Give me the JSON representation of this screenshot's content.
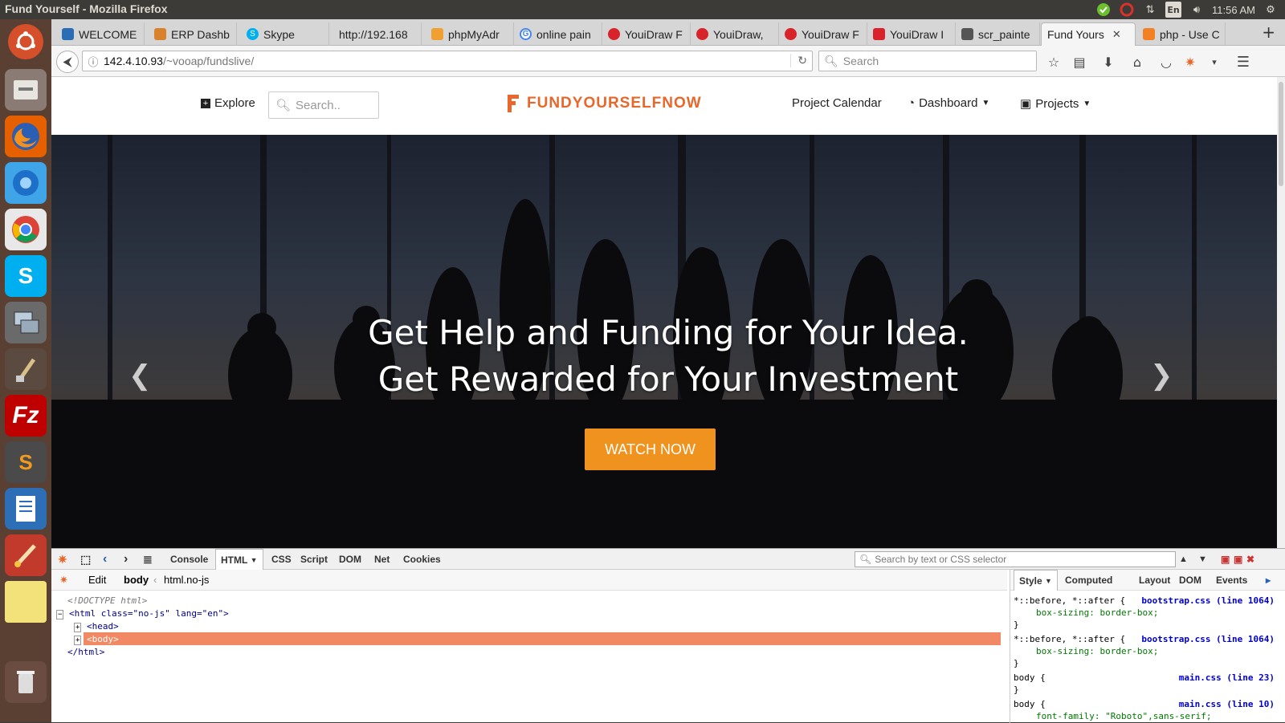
{
  "system": {
    "window_title": "Fund Yourself - Mozilla Firefox",
    "clock": "11:56 AM",
    "lang": "En"
  },
  "tabs": [
    {
      "label": "WELCOME TO",
      "fav": "#2a6db5"
    },
    {
      "label": "ERP Dashb",
      "fav": "#d9822b"
    },
    {
      "label": "Skype",
      "fav": "#00aff0"
    },
    {
      "label": "http://192.168",
      "fav": ""
    },
    {
      "label": "phpMyAdr",
      "fav": "#f0a030"
    },
    {
      "label": "online pain",
      "fav": "#4285f4"
    },
    {
      "label": "YouiDraw F",
      "fav": "#d8232a"
    },
    {
      "label": "YouiDraw,",
      "fav": "#d8232a"
    },
    {
      "label": "YouiDraw F",
      "fav": "#d8232a"
    },
    {
      "label": "YouiDraw I",
      "fav": "#d8232a"
    },
    {
      "label": "scr_painte",
      "fav": "#555"
    },
    {
      "label": "Fund Yours",
      "fav": "",
      "active": true
    },
    {
      "label": "php - Use C",
      "fav": "#f48024"
    }
  ],
  "nav": {
    "url_host": "142.4.10.93",
    "url_path": "/~vooap/fundslive/",
    "search_placeholder": "Search"
  },
  "site": {
    "explore": "Explore",
    "search_placeholder": "Search..",
    "logo": "FUNDYOURSELFNOW",
    "calendar": "Project Calendar",
    "dashboard": "Dashboard",
    "projects": "Projects",
    "accent": "#e8672a"
  },
  "hero": {
    "line1": "Get Help and Funding for Your Idea.",
    "line2": "Get Rewarded for Your Investment",
    "cta": "WATCH NOW",
    "cta_color": "#f0921e"
  },
  "devtools": {
    "tabs": [
      "Console",
      "HTML",
      "CSS",
      "Script",
      "DOM",
      "Net",
      "Cookies"
    ],
    "active_tab": "HTML",
    "search_placeholder": "Search by text or CSS selector",
    "edit": "Edit",
    "crumb_body": "body",
    "crumb_html": "html.no-js",
    "tree": {
      "doctype": "<!DOCTYPE html>",
      "html_open": "<html class=\"no-js\" lang=\"en\">",
      "head": "<head>",
      "body": "<body>",
      "html_close": "</html>"
    },
    "side_tabs": [
      "Style",
      "Computed",
      "Layout",
      "DOM",
      "Events"
    ],
    "rules": [
      {
        "selector": "*::before, *::after {",
        "prop": "box-sizing: border-box;",
        "src": "bootstrap.css (line 1064)"
      },
      {
        "selector": "*::before, *::after {",
        "prop": "box-sizing: border-box;",
        "src": "bootstrap.css (line 1064)"
      },
      {
        "selector": "body {",
        "prop": "",
        "src": "main.css (line 23)"
      },
      {
        "selector": "body {",
        "prop": "font-family: \"Roboto\",sans-serif;",
        "src": "main.css (line 10)"
      }
    ]
  }
}
